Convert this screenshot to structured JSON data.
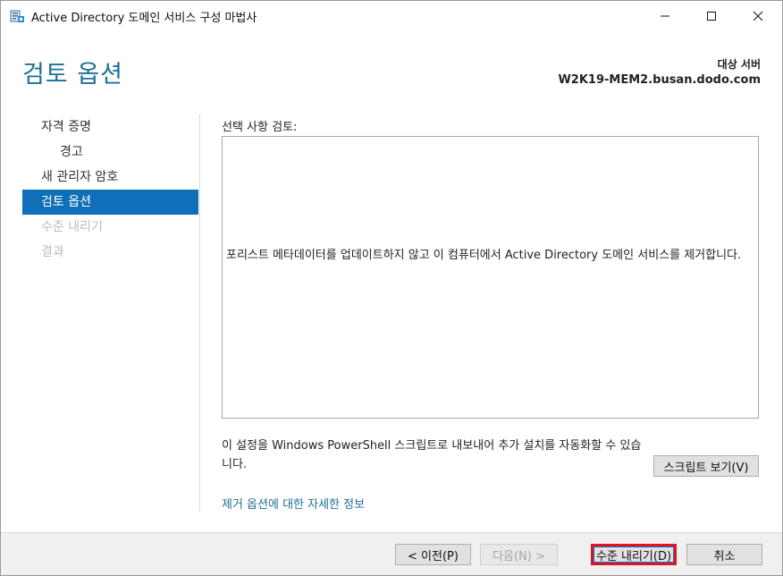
{
  "window": {
    "title": "Active Directory 도메인 서비스 구성 마법사",
    "icon": "ad-wizard-icon"
  },
  "header": {
    "page_title": "검토 옵션",
    "target_label": "대상 서버",
    "target_server": "W2K19-MEM2.busan.dodo.com"
  },
  "nav": {
    "items": [
      {
        "label": "자격 증명",
        "state": "normal"
      },
      {
        "label": "경고",
        "state": "sub"
      },
      {
        "label": "새 관리자 암호",
        "state": "normal"
      },
      {
        "label": "검토 옵션",
        "state": "active"
      },
      {
        "label": "수준 내리기",
        "state": "disabled"
      },
      {
        "label": "결과",
        "state": "disabled"
      }
    ]
  },
  "content": {
    "review_label": "선택 사항 검토:",
    "review_text": "포리스트 메타데이터를 업데이트하지 않고 이 컴퓨터에서 Active Directory 도메인 서비스를 제거합니다.",
    "export_text": "이 설정을 Windows PowerShell 스크립트로 내보내어 추가 설치를 자동화할 수 있습니다.",
    "view_script_label": "스크립트 보기(V)",
    "more_info_link": "제거 옵션에 대한 자세한 정보"
  },
  "footer": {
    "prev_label": "< 이전(P)",
    "next_label": "다음(N) >",
    "demote_label": "수준 내리기(D)",
    "cancel_label": "취소"
  },
  "colors": {
    "accent": "#1e6f97",
    "nav_active": "#0f6fb8",
    "highlight": "#e81123"
  }
}
